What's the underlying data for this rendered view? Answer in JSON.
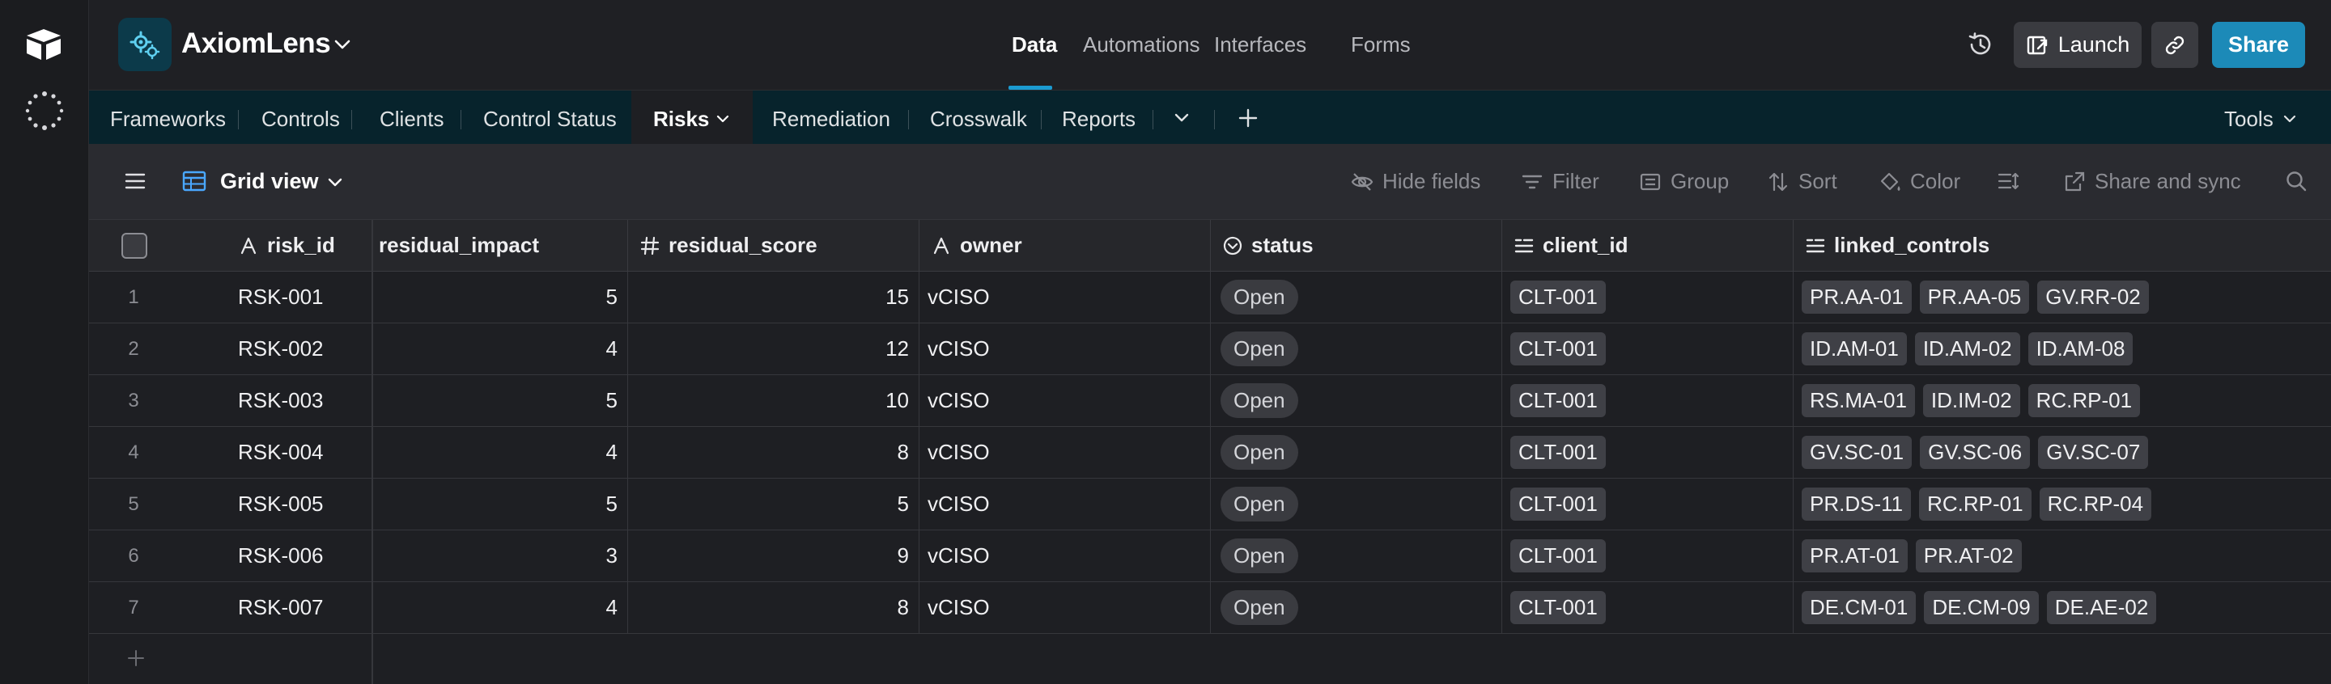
{
  "app": {
    "name": "AxiomLens"
  },
  "topnav": [
    {
      "label": "Data",
      "active": true
    },
    {
      "label": "Automations",
      "active": false
    },
    {
      "label": "Interfaces",
      "active": false
    },
    {
      "label": "Forms",
      "active": false
    }
  ],
  "header_actions": {
    "launch": "Launch",
    "share": "Share"
  },
  "tables": [
    "Frameworks",
    "Controls",
    "Clients",
    "Control Status",
    "Risks",
    "Remediation",
    "Crosswalk",
    "Reports"
  ],
  "active_table": "Risks",
  "tools_label": "Tools",
  "view": {
    "name": "Grid view",
    "tools": {
      "hide_fields": "Hide fields",
      "filter": "Filter",
      "group": "Group",
      "sort": "Sort",
      "color": "Color",
      "share_sync": "Share and sync"
    }
  },
  "columns": {
    "risk_id": "risk_id",
    "residual_impact": "residual_impact",
    "residual_score": "residual_score",
    "owner": "owner",
    "status": "status",
    "client_id": "client_id",
    "linked_controls": "linked_controls"
  },
  "rows": [
    {
      "n": "1",
      "risk_id": "RSK-001",
      "impact": "5",
      "score": "15",
      "owner": "vCISO",
      "status": "Open",
      "client": "CLT-001",
      "controls": [
        "PR.AA-01",
        "PR.AA-05",
        "GV.RR-02"
      ]
    },
    {
      "n": "2",
      "risk_id": "RSK-002",
      "impact": "4",
      "score": "12",
      "owner": "vCISO",
      "status": "Open",
      "client": "CLT-001",
      "controls": [
        "ID.AM-01",
        "ID.AM-02",
        "ID.AM-08"
      ]
    },
    {
      "n": "3",
      "risk_id": "RSK-003",
      "impact": "5",
      "score": "10",
      "owner": "vCISO",
      "status": "Open",
      "client": "CLT-001",
      "controls": [
        "RS.MA-01",
        "ID.IM-02",
        "RC.RP-01"
      ]
    },
    {
      "n": "4",
      "risk_id": "RSK-004",
      "impact": "4",
      "score": "8",
      "owner": "vCISO",
      "status": "Open",
      "client": "CLT-001",
      "controls": [
        "GV.SC-01",
        "GV.SC-06",
        "GV.SC-07"
      ]
    },
    {
      "n": "5",
      "risk_id": "RSK-005",
      "impact": "5",
      "score": "5",
      "owner": "vCISO",
      "status": "Open",
      "client": "CLT-001",
      "controls": [
        "PR.DS-11",
        "RC.RP-01",
        "RC.RP-04"
      ]
    },
    {
      "n": "6",
      "risk_id": "RSK-006",
      "impact": "3",
      "score": "9",
      "owner": "vCISO",
      "status": "Open",
      "client": "CLT-001",
      "controls": [
        "PR.AT-01",
        "PR.AT-02"
      ]
    },
    {
      "n": "7",
      "risk_id": "RSK-007",
      "impact": "4",
      "score": "8",
      "owner": "vCISO",
      "status": "Open",
      "client": "CLT-001",
      "controls": [
        "DE.CM-01",
        "DE.CM-09",
        "DE.AE-02"
      ]
    }
  ],
  "colors": {
    "accent": "#1c8ab8",
    "tabs_bg": "#07232c",
    "toolbar_bg": "#2a2b30",
    "grid_bg": "#1e1f23"
  }
}
